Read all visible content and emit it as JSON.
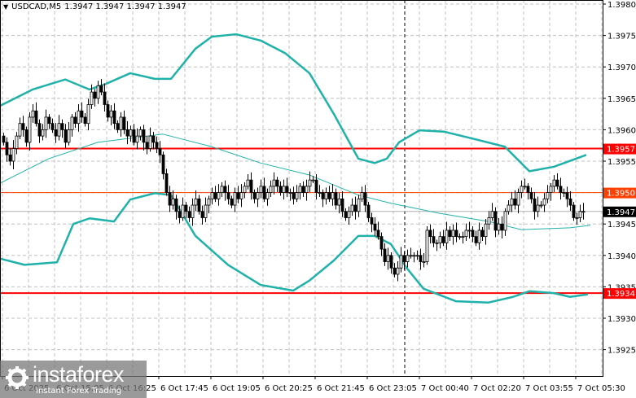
{
  "header": {
    "symbol": "USDCAD,M5",
    "ohlc": "1.3947 1.3947 1.3947 1.3947"
  },
  "watermark": {
    "brand": "instaforex",
    "tagline": "Instant Forex Trading"
  },
  "colors": {
    "band": "#20b2aa",
    "support_resistance": "#ff0000",
    "level_orange": "#ff4000",
    "bid": "#000000",
    "grid": "#c0c0c0"
  },
  "chart_data": {
    "type": "candlestick",
    "title": "USDCAD,M5",
    "ylim": [
      1.392,
      1.398
    ],
    "y_ticks": [
      "1.3980",
      "1.3975",
      "1.3970",
      "1.3965",
      "1.3960",
      "1.3955",
      "1.3950",
      "1.3945",
      "1.3940",
      "1.3935",
      "1.3930",
      "1.3925"
    ],
    "x_ticks": [
      {
        "bar": 0,
        "label": "6 Oct 2025"
      },
      {
        "bar": 16,
        "label": "6 Oct 15:05"
      },
      {
        "bar": 32,
        "label": "6 Oct 16:25"
      },
      {
        "bar": 48,
        "label": "6 Oct 17:45"
      },
      {
        "bar": 64,
        "label": "6 Oct 19:05"
      },
      {
        "bar": 80,
        "label": "6 Oct 20:25"
      },
      {
        "bar": 96,
        "label": "6 Oct 21:45"
      },
      {
        "bar": 112,
        "label": "6 Oct 23:05"
      },
      {
        "bar": 128,
        "label": "7 Oct 00:40"
      },
      {
        "bar": 144,
        "label": "7 Oct 02:20"
      },
      {
        "bar": 160,
        "label": "7 Oct 03:55"
      },
      {
        "bar": 176,
        "label": "7 Oct 05:30"
      }
    ],
    "closes": [
      1.3958,
      1.3956,
      1.3955,
      1.3957,
      1.3959,
      1.3961,
      1.396,
      1.3958,
      1.3962,
      1.3963,
      1.3961,
      1.3959,
      1.396,
      1.3962,
      1.3961,
      1.396,
      1.3959,
      1.3961,
      1.396,
      1.3958,
      1.396,
      1.3962,
      1.3961,
      1.3963,
      1.3962,
      1.3961,
      1.3964,
      1.3966,
      1.3965,
      1.3967,
      1.3966,
      1.3964,
      1.3962,
      1.3963,
      1.3961,
      1.396,
      1.3962,
      1.396,
      1.3959,
      1.396,
      1.3958,
      1.3959,
      1.396,
      1.3958,
      1.3957,
      1.3959,
      1.3958,
      1.3957,
      1.3956,
      1.3953,
      1.395,
      1.3948,
      1.3949,
      1.3947,
      1.3946,
      1.3948,
      1.3947,
      1.3946,
      1.3948,
      1.3949,
      1.3947,
      1.3946,
      1.3948,
      1.3949,
      1.395,
      1.3949,
      1.395,
      1.3951,
      1.395,
      1.3949,
      1.3948,
      1.395,
      1.3949,
      1.395,
      1.3951,
      1.3952,
      1.395,
      1.3949,
      1.395,
      1.3951,
      1.3949,
      1.395,
      1.3951,
      1.3952,
      1.3951,
      1.395,
      1.3951,
      1.395,
      1.395,
      1.3949,
      1.395,
      1.3951,
      1.395,
      1.3951,
      1.3952,
      1.3952,
      1.395,
      1.395,
      1.3949,
      1.395,
      1.3949,
      1.395,
      1.3948,
      1.3949,
      1.3947,
      1.3946,
      1.3947,
      1.3948,
      1.3947,
      1.3949,
      1.395,
      1.3948,
      1.3946,
      1.3945,
      1.3944,
      1.3943,
      1.3941,
      1.3939,
      1.394,
      1.3938,
      1.3937,
      1.3938,
      1.394,
      1.3939,
      1.394,
      1.394,
      1.394,
      1.394,
      1.3939,
      1.3939,
      1.3944,
      1.3943,
      1.3942,
      1.3942,
      1.3943,
      1.3942,
      1.3944,
      1.3943,
      1.3944,
      1.3943,
      1.3943,
      1.3943,
      1.3944,
      1.3944,
      1.3943,
      1.3942,
      1.3944,
      1.3943,
      1.3945,
      1.3946,
      1.3947,
      1.3944,
      1.3945,
      1.3944,
      1.3947,
      1.3948,
      1.3949,
      1.3948,
      1.395,
      1.3951,
      1.3951,
      1.395,
      1.3949,
      1.3947,
      1.3948,
      1.3948,
      1.3949,
      1.395,
      1.3951,
      1.3952,
      1.3951,
      1.395,
      1.395,
      1.3949,
      1.3948,
      1.3946,
      1.3946,
      1.3947,
      1.3947
    ],
    "bollinger_upper": [
      [
        -1,
        1.39638
      ],
      [
        9,
        1.39664
      ],
      [
        19,
        1.3968
      ],
      [
        26.5,
        1.39664
      ],
      [
        31.5,
        1.39673
      ],
      [
        39,
        1.3969
      ],
      [
        46.5,
        1.39681
      ],
      [
        51.5,
        1.39681
      ],
      [
        59,
        1.39729
      ],
      [
        64,
        1.39748
      ],
      [
        71.5,
        1.39752
      ],
      [
        79,
        1.39742
      ],
      [
        86.5,
        1.39722
      ],
      [
        94,
        1.3969
      ],
      [
        101.5,
        1.39625
      ],
      [
        109,
        1.39554
      ],
      [
        114,
        1.39547
      ],
      [
        117.75,
        1.39554
      ],
      [
        121.5,
        1.3958
      ],
      [
        127.75,
        1.39599
      ],
      [
        135.25,
        1.39597
      ],
      [
        144,
        1.39586
      ],
      [
        154,
        1.39573
      ],
      [
        161.5,
        1.39534
      ],
      [
        169,
        1.39541
      ],
      [
        179,
        1.3956
      ]
    ],
    "bollinger_middle": [
      [
        -1,
        1.39515
      ],
      [
        14,
        1.39554
      ],
      [
        29,
        1.3958
      ],
      [
        49,
        1.39593
      ],
      [
        64,
        1.39573
      ],
      [
        79,
        1.39547
      ],
      [
        94,
        1.39528
      ],
      [
        109,
        1.39496
      ],
      [
        119,
        1.39483
      ],
      [
        134,
        1.39467
      ],
      [
        149,
        1.39454
      ],
      [
        159,
        1.39441
      ],
      [
        174,
        1.39444
      ],
      [
        180.25,
        1.39448
      ]
    ],
    "bollinger_lower": [
      [
        -1,
        1.39395
      ],
      [
        6.5,
        1.39385
      ],
      [
        16.5,
        1.39389
      ],
      [
        21.5,
        1.3945
      ],
      [
        26.5,
        1.39459
      ],
      [
        34,
        1.39454
      ],
      [
        39,
        1.39489
      ],
      [
        46.5,
        1.39499
      ],
      [
        51.5,
        1.39496
      ],
      [
        59,
        1.39431
      ],
      [
        69,
        1.39385
      ],
      [
        79,
        1.39353
      ],
      [
        89,
        1.39344
      ],
      [
        94,
        1.3936
      ],
      [
        101.5,
        1.39392
      ],
      [
        109,
        1.39431
      ],
      [
        114,
        1.39431
      ],
      [
        119,
        1.39418
      ],
      [
        124,
        1.39379
      ],
      [
        129,
        1.39347
      ],
      [
        139,
        1.39327
      ],
      [
        149,
        1.39325
      ],
      [
        156.5,
        1.39334
      ],
      [
        161.5,
        1.39343
      ],
      [
        169,
        1.3934
      ],
      [
        174,
        1.39334
      ],
      [
        179.5,
        1.39338
      ]
    ],
    "levels": [
      {
        "price": 1.3957,
        "label": "1.3957",
        "kind": "resistance"
      },
      {
        "price": 1.3934,
        "label": "1.3934",
        "kind": "support"
      },
      {
        "price": 1.395,
        "label": "1.3950",
        "kind": "orange"
      },
      {
        "price": 1.3947,
        "label": "1.3947",
        "kind": "bid"
      }
    ],
    "separator_bar": 123
  }
}
